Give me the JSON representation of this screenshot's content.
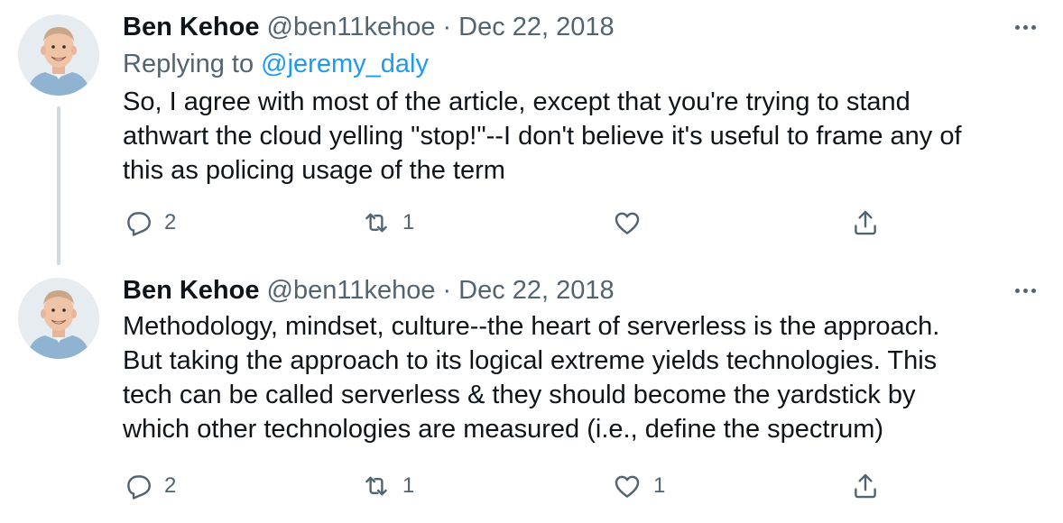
{
  "tweets": [
    {
      "author_name": "Ben Kehoe",
      "handle": "@ben11kehoe",
      "separator": "·",
      "date": "Dec 22, 2018",
      "replying_prefix": "Replying to ",
      "replying_to": "@jeremy_daly",
      "text": "So, I agree with most of the article, except that you're trying to stand\nathwart the cloud yelling \"stop!\"--I don't believe it's useful to frame any of\nthis as policing usage of the term",
      "reply_count": "2",
      "retweet_count": "1",
      "like_count": "",
      "avatar_icon": "avatar-photo"
    },
    {
      "author_name": "Ben Kehoe",
      "handle": "@ben11kehoe",
      "separator": "·",
      "date": "Dec 22, 2018",
      "text": "Methodology, mindset, culture--the heart of serverless is the approach.\nBut taking the approach to its logical extreme yields technologies. This\ntech can be called serverless & they should become the yardstick by\nwhich other technologies are measured (i.e., define the spectrum)",
      "reply_count": "2",
      "retweet_count": "1",
      "like_count": "1",
      "avatar_icon": "avatar-photo"
    }
  ],
  "colors": {
    "text_primary": "#0f1419",
    "text_secondary": "#536471",
    "mention": "#1d9bf0",
    "thread_line": "#cfd9de"
  },
  "icons": {
    "reply": "reply-bubble-icon",
    "retweet": "retweet-arrows-icon",
    "like": "heart-outline-icon",
    "share": "share-upload-icon",
    "more": "more-dots-icon"
  }
}
